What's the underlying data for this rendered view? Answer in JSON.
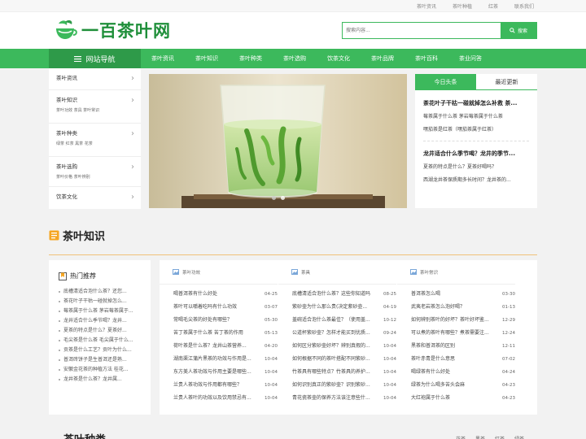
{
  "topbar": {
    "links": [
      "茶叶资讯",
      "茶叶种植",
      "红茶",
      "联系我们"
    ]
  },
  "logo": {
    "text": "一百茶叶网"
  },
  "search": {
    "placeholder": "搜索内容...",
    "button": "搜索"
  },
  "nav": {
    "title": "网站导航",
    "items": [
      "茶叶资讯",
      "茶叶知识",
      "茶叶种类",
      "茶叶选购",
      "饮茶文化",
      "茶叶品牌",
      "茶叶百科",
      "茶业问答"
    ]
  },
  "sidemenu": [
    {
      "title": "茶叶资讯",
      "sub": ""
    },
    {
      "title": "茶叶知识",
      "sub": "茶叶功效  茶具  茶叶常识"
    },
    {
      "title": "茶叶种类",
      "sub": "绿茶  红茶  黑茶  花茶"
    },
    {
      "title": "茶叶选购",
      "sub": "茶叶价格  茶叶辨别"
    },
    {
      "title": "饮茶文化",
      "sub": ""
    }
  ],
  "newsbox": {
    "tabs": [
      "今日头条",
      "最近更新"
    ],
    "groups": [
      {
        "head": "茶花叶子干枯一碰就掉怎么补救 茶...",
        "links": [
          "莓茶属于什么茶 茅岩莓茶属于什么茶",
          "嘿茄茶是红茶（嘿茄茶属于红茶）"
        ]
      },
      {
        "head": "龙井适合什么季节喝？龙井的季节...",
        "links": [
          "夏茶的特点是什么？夏茶好喝吗？",
          "西湖龙井茶保质期多长时间？龙井茶的..."
        ]
      }
    ]
  },
  "section": {
    "title": "茶叶知识"
  },
  "hot": {
    "title": "热门推荐",
    "items": [
      "底槽清适合泡什么茶？还您...",
      "茶花叶子干枯一碰就掉怎么...",
      "莓茶属于什么茶 茅岩莓茶属于...",
      "龙井适合什么季节喝？龙井...",
      "夏茶的特点是什么？夏茶好...",
      "毛尖茶是什么茶 毛尖属于什么...",
      "贡茶是什么工艺？贡叶为什么...",
      "普洱砖饼子是生普洱还是熟...",
      "安徽金花茶的种植方法 桂花...",
      "龙井茶是什么茶？龙井属..."
    ]
  },
  "columns": [
    {
      "title": "茶叶功效",
      "rows": [
        {
          "t": "喝普洱茶有什么好处",
          "d": "04-25"
        },
        {
          "t": "茶叶可以嚼着吃吗有什么功效",
          "d": "03-07"
        },
        {
          "t": "常喝毛尖茶的好处有哪些？",
          "d": "05-30"
        },
        {
          "t": "苦丁茶属于什么茶 苦丁茶的作用",
          "d": "05-13"
        },
        {
          "t": "荷叶茶是什么茶？龙井山茶营养...",
          "d": "04-20"
        },
        {
          "t": "湖南渠江蒲片黑茶的功效与作用是...",
          "d": "10-04"
        },
        {
          "t": "东方美人茶功效与作用主要是哪些...",
          "d": "10-04"
        },
        {
          "t": "兰贵人茶功效与作用都有哪些？",
          "d": "10-04"
        },
        {
          "t": "兰贵人茶叶的功效以及饮用禁忌有...",
          "d": "10-04"
        }
      ]
    },
    {
      "title": "茶具",
      "rows": [
        {
          "t": "底槽清适合泡什么茶？这些你知道吗",
          "d": "08-25"
        },
        {
          "t": "紫砂壶为什么那么贵(决定紫砂壶...",
          "d": "04-19"
        },
        {
          "t": "盖碗适合泡什么茶最佳？（使用盖...",
          "d": "10-12"
        },
        {
          "t": "公道杯紫砂壶？怎样才能买到优质...",
          "d": "09-24"
        },
        {
          "t": "如何区分紫砂壶好坏？辨别真假的...",
          "d": "10-04"
        },
        {
          "t": "如何根据不同的茶叶搭配不同紫砂...",
          "d": "10-04"
        },
        {
          "t": "竹茶具有哪些特点？竹茶具的养护...",
          "d": "10-04"
        },
        {
          "t": "如何识别真正的紫砂壶？识别紫砂...",
          "d": "10-04"
        },
        {
          "t": "青花瓷茶壶的保养方法该注意些什...",
          "d": "10-04"
        }
      ]
    },
    {
      "title": "茶叶常识",
      "rows": [
        {
          "t": "普洱茶怎么喝",
          "d": "03-30"
        },
        {
          "t": "武夷老岩茶怎么泡好喝？",
          "d": "01-13"
        },
        {
          "t": "如何辨别茶叶的好坏？茶叶好坏鉴...",
          "d": "12-29"
        },
        {
          "t": "可以煮的茶叶有哪些？煮茶需要注...",
          "d": "12-24"
        },
        {
          "t": "黑茶和普洱茶的区别",
          "d": "12-11"
        },
        {
          "t": "茶叶赤青是什么意思",
          "d": "07-02"
        },
        {
          "t": "喝绿茶有什么好处",
          "d": "04-24"
        },
        {
          "t": "绿茶为什么喝多苦头会麻",
          "d": "04-23"
        },
        {
          "t": "大红袍属于什么茶",
          "d": "04-23"
        }
      ]
    }
  ],
  "next_section": {
    "title": "茶叶种类",
    "tags": [
      "花茶",
      "黑茶",
      "红茶",
      "绿茶"
    ]
  },
  "colors": {
    "brand_green": "#3cb95c",
    "nav_dark": "#2e9a49",
    "accent_orange": "#f5a623"
  }
}
